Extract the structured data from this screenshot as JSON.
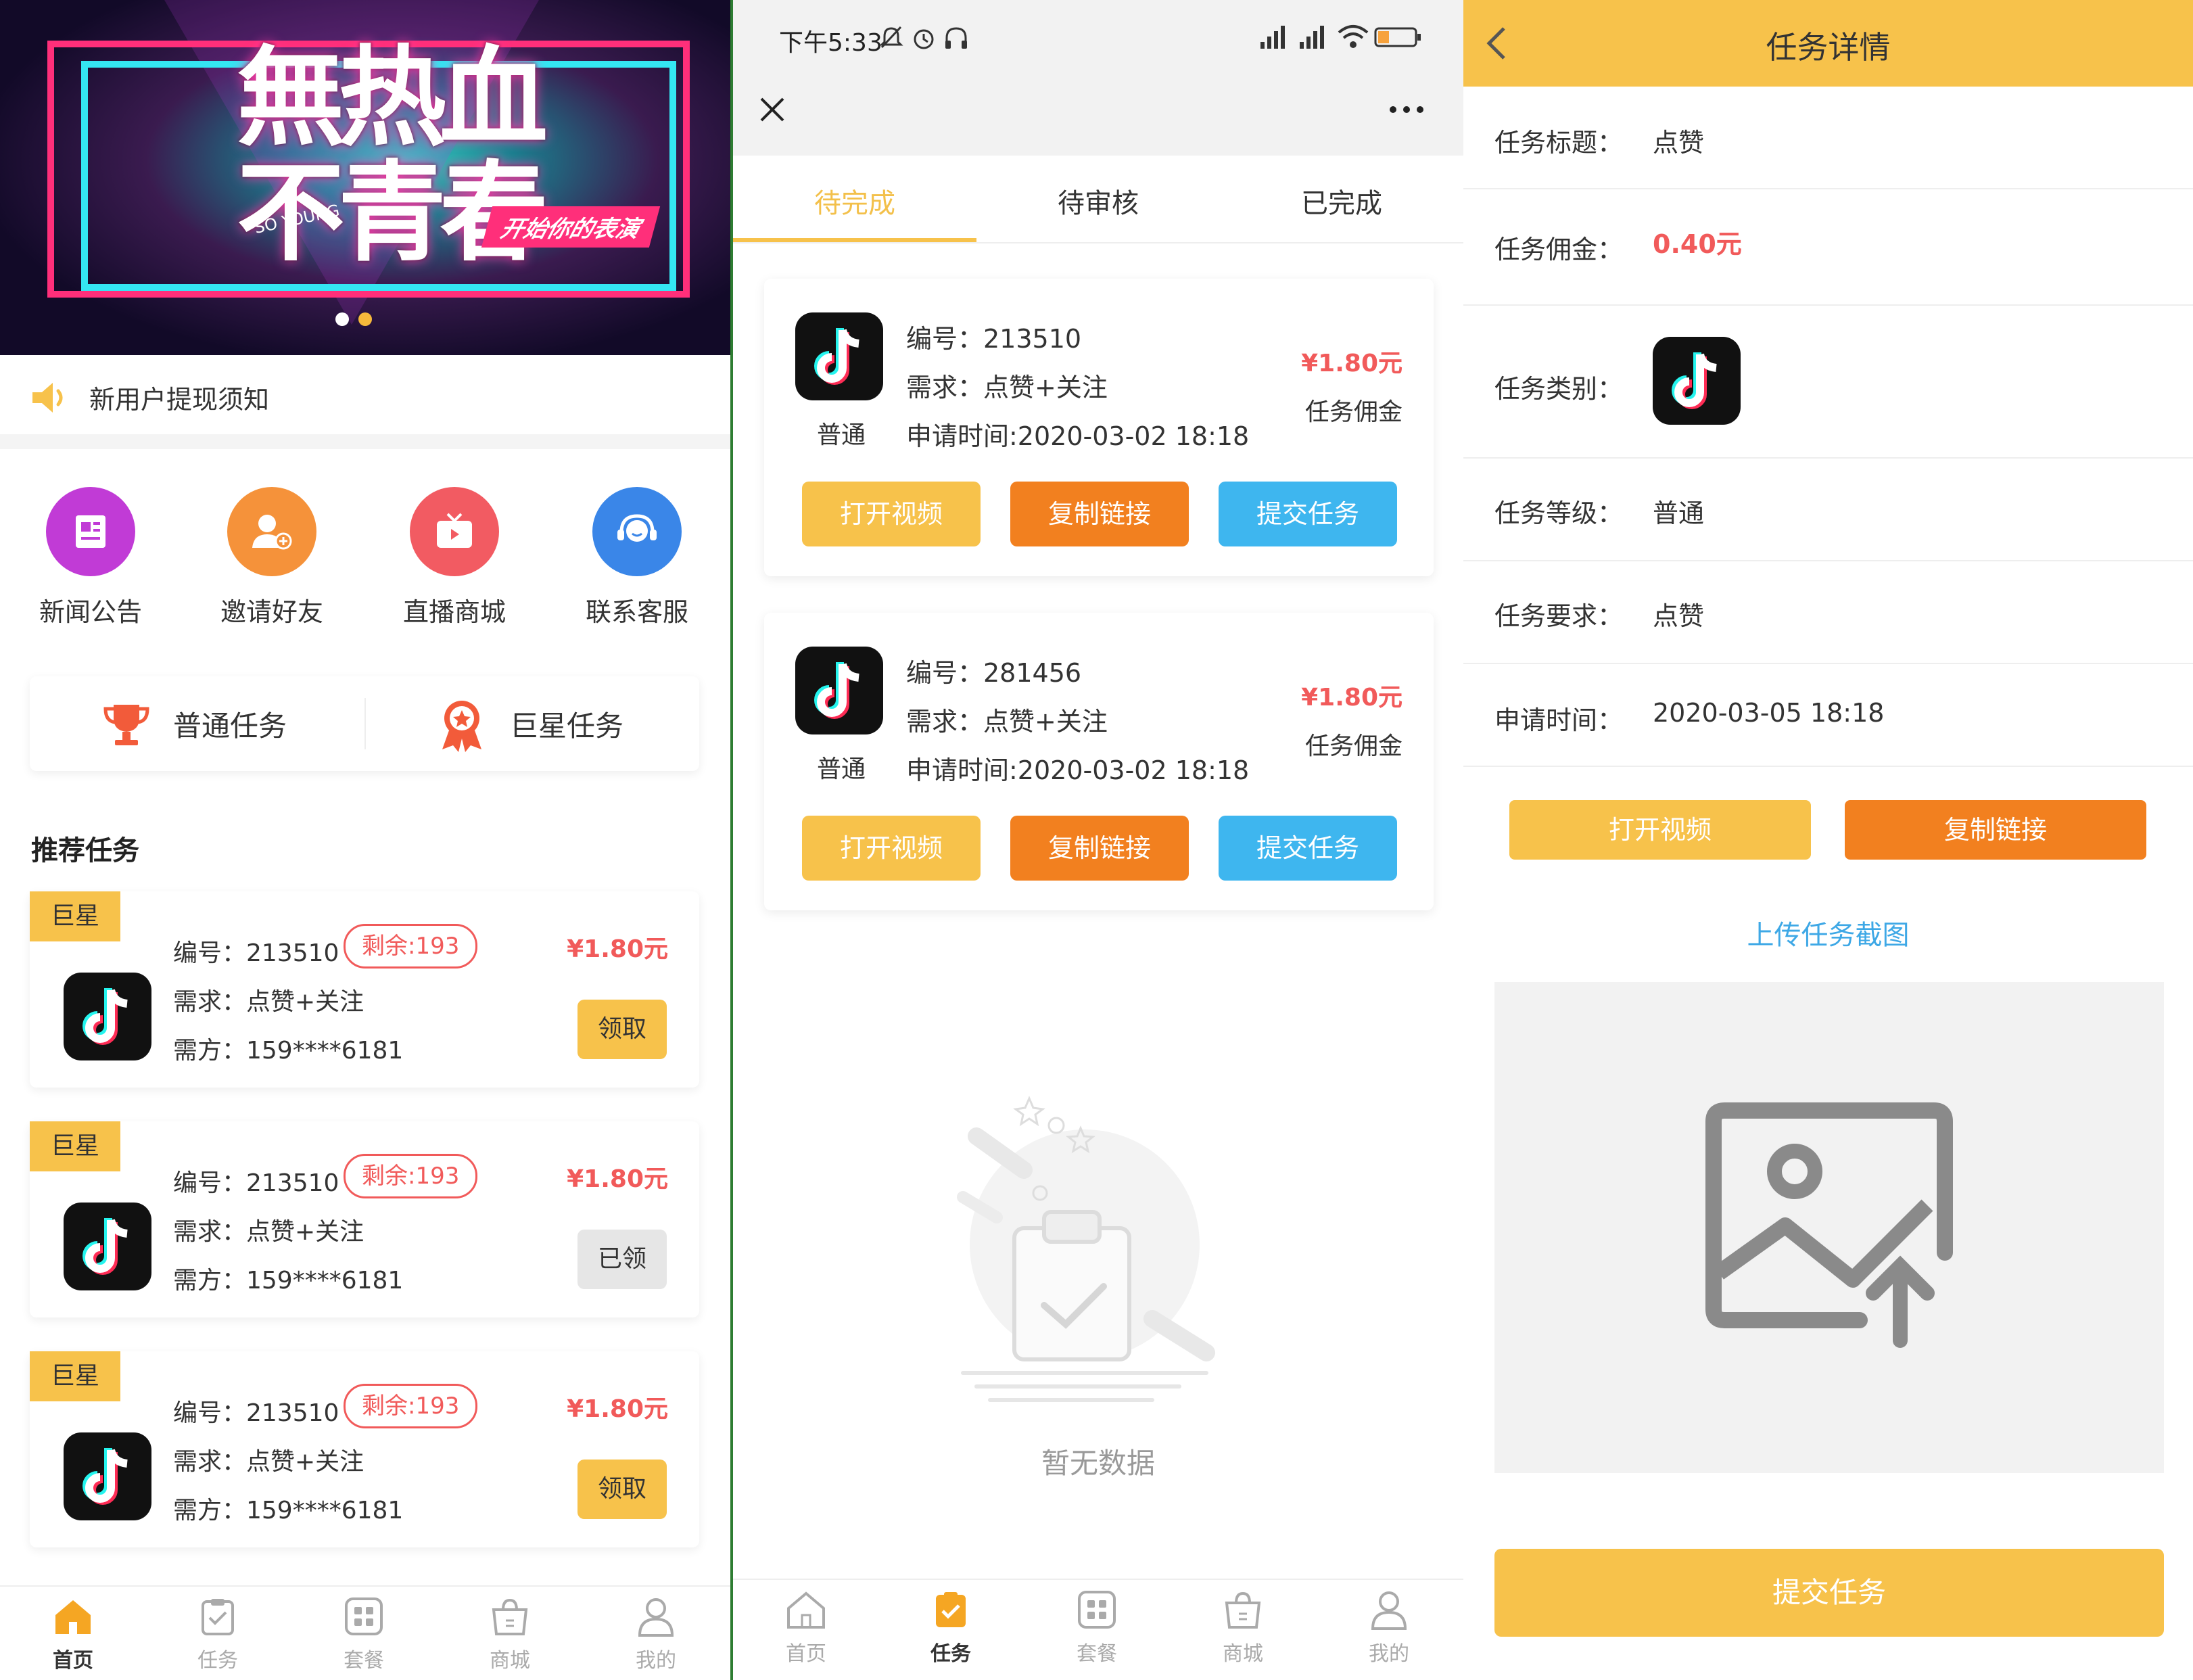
{
  "home": {
    "banner": {
      "big_text": "無热血\n不青春",
      "small_text": "SO YOUNG",
      "slogan": "开始你的表演"
    },
    "notice": "新用户提现须知",
    "icons": [
      {
        "label": "新闻公告",
        "icon": "news-icon",
        "color": "#c13bd6"
      },
      {
        "label": "邀请好友",
        "icon": "add-user-icon",
        "color": "#f5923a"
      },
      {
        "label": "直播商城",
        "icon": "tv-icon",
        "color": "#f25b62"
      },
      {
        "label": "联系客服",
        "icon": "headset-icon",
        "color": "#3a86e8"
      }
    ],
    "task_types": [
      "普通任务",
      "巨星任务"
    ],
    "section_title": "推荐任务",
    "recommend": [
      {
        "tag": "巨星",
        "id": "编号：213510",
        "remain": "剩余:193",
        "need": "需求：点赞+关注",
        "owner": "需方：159****6181",
        "price": "¥1.80元",
        "action": "领取",
        "taken": false
      },
      {
        "tag": "巨星",
        "id": "编号：213510",
        "remain": "剩余:193",
        "need": "需求：点赞+关注",
        "owner": "需方：159****6181",
        "price": "¥1.80元",
        "action": "已领",
        "taken": true
      },
      {
        "tag": "巨星",
        "id": "编号：213510",
        "remain": "剩余:193",
        "need": "需求：点赞+关注",
        "owner": "需方：159****6181",
        "price": "¥1.80元",
        "action": "领取",
        "taken": false
      }
    ]
  },
  "tabbar": [
    {
      "label": "首页",
      "icon": "home-icon"
    },
    {
      "label": "任务",
      "icon": "task-icon"
    },
    {
      "label": "套餐",
      "icon": "package-icon"
    },
    {
      "label": "商城",
      "icon": "shop-icon"
    },
    {
      "label": "我的",
      "icon": "user-icon"
    }
  ],
  "tasks": {
    "status_time": "下午5:33",
    "tabs": [
      "待完成",
      "待审核",
      "已完成"
    ],
    "cards": [
      {
        "level": "普通",
        "id": "编号：213510",
        "need": "需求：点赞+关注",
        "time": "申请时间:2020-03-02 18:18",
        "price": "¥1.80元",
        "price_label": "任务佣金"
      },
      {
        "level": "普通",
        "id": "编号：281456",
        "need": "需求：点赞+关注",
        "time": "申请时间:2020-03-02 18:18",
        "price": "¥1.80元",
        "price_label": "任务佣金"
      }
    ],
    "buttons": [
      "打开视频",
      "复制链接",
      "提交任务"
    ],
    "empty_text": "暂无数据"
  },
  "detail": {
    "title": "任务详情",
    "rows": [
      {
        "k": "任务标题：",
        "v": "点赞"
      },
      {
        "k": "任务佣金：",
        "v": "0.40元"
      },
      {
        "k": "任务类别：",
        "v": ""
      },
      {
        "k": "任务等级：",
        "v": "普通"
      },
      {
        "k": "任务要求：",
        "v": "点赞"
      },
      {
        "k": "申请时间：",
        "v": "2020-03-05 18:18"
      }
    ],
    "open_video": "打开视频",
    "copy_link": "复制链接",
    "upload_label": "上传任务截图",
    "submit": "提交任务"
  },
  "colors": {
    "accent": "#f7c24b",
    "price": "#f15a5a",
    "orange": "#f2801f",
    "blue": "#3eb6ef"
  }
}
